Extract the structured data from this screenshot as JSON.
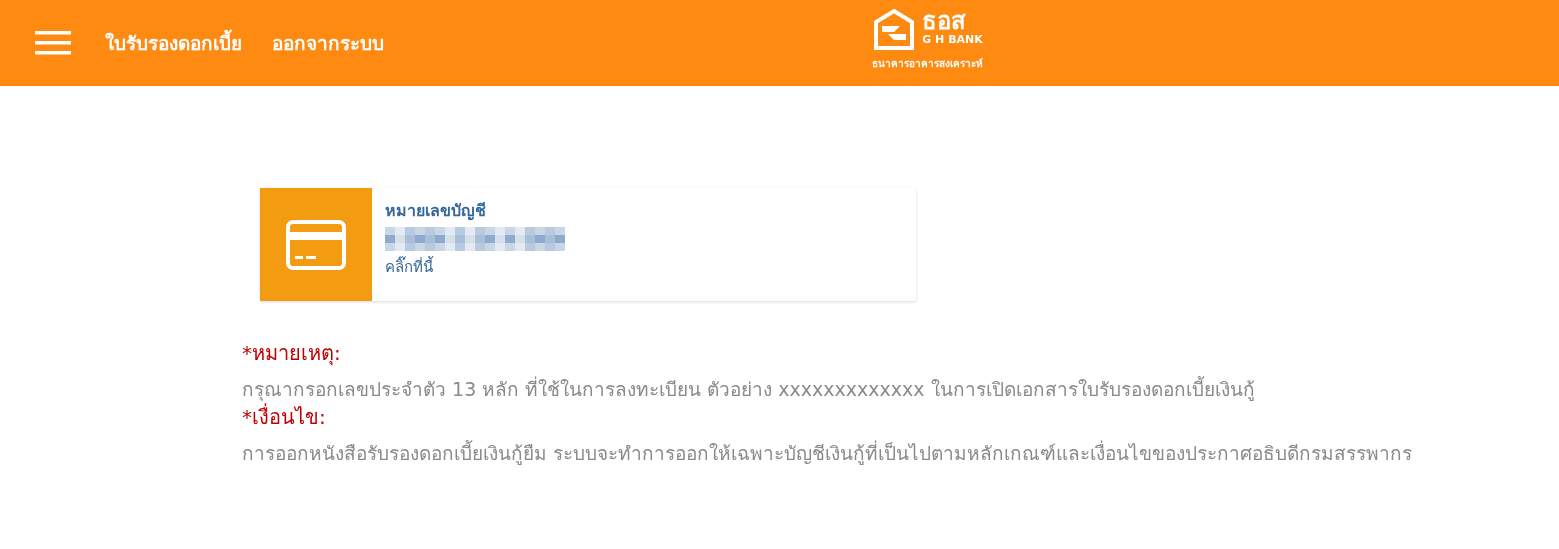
{
  "header": {
    "menu": [
      {
        "label": "ใบรับรองดอกเบี้ย"
      },
      {
        "label": "ออกจากระบบ"
      }
    ],
    "logo": {
      "name": "ธอส",
      "brand": "G H BANK",
      "subtitle": "ธนาคารอาคารสงเคราะห์"
    }
  },
  "account_card": {
    "title": "หมายเลขบัญชี",
    "link": "คลิ๊กที่นี้"
  },
  "notes": [
    {
      "kind": "heading",
      "text": "*หมายเหตุ:"
    },
    {
      "kind": "body",
      "text": "กรุณากรอกเลขประจำตัว 13 หลัก ที่ใช้ในการลงทะเบียน ตัวอย่าง xxxxxxxxxxxxx ในการเปิดเอกสารใบรับรองดอกเบี้ยเงินกู้"
    },
    {
      "kind": "heading",
      "text": "*เงื่อนไข:"
    },
    {
      "kind": "body",
      "text": "การออกหนังสือรับรองดอกเบี้ยเงินกู้ยืม ระบบจะทำการออกให้เฉพาะบัญชีเงินกู้ที่เป็นไปตามหลักเกณฑ์และเงื่อนไขของประกาศอธิบดีกรมสรรพากร"
    }
  ]
}
